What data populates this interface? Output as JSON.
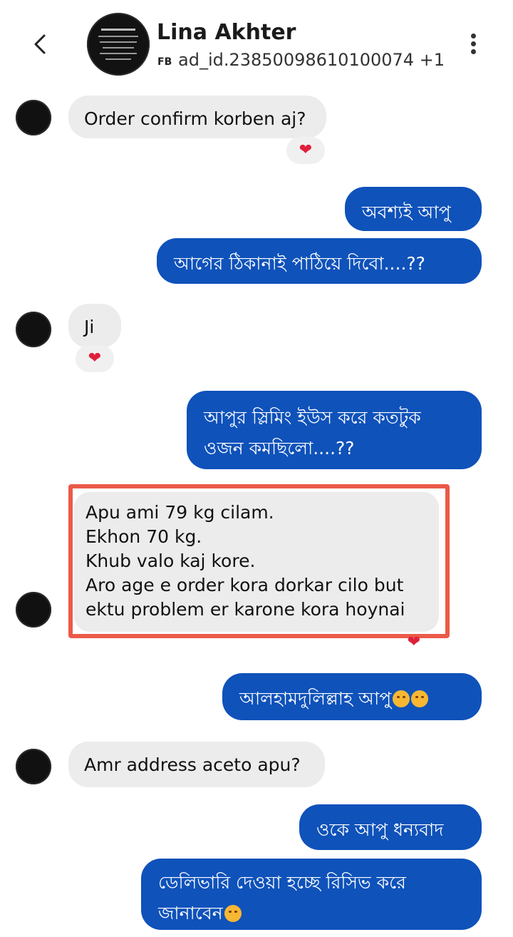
{
  "header": {
    "contact_name": "Lina Akhter",
    "source_badge": "FB",
    "subtitle": "ad_id.23850098610100074 +1",
    "back_icon": "chevron-left-icon",
    "more_icon": "more-vertical-icon"
  },
  "messages": [
    {
      "text": "Order confirm korben aj?",
      "reaction": "❤"
    },
    {
      "text": "অবশ্যই আপু"
    },
    {
      "text": "আগের ঠিকানাই পাঠিয়ে দিবো....??"
    },
    {
      "text": "Ji",
      "reaction": "❤"
    },
    {
      "lines": [
        "আপুর  স্লিমিং ইউস করে কতটুক",
        "ওজন কমছিলো....??"
      ]
    },
    {
      "lines": [
        "Apu ami 79 kg cilam.",
        "Ekhon 70 kg.",
        "Khub valo kaj kore.",
        "Aro age e order kora dorkar cilo but",
        "ektu problem er karone kora hoynai"
      ]
    },
    {
      "text": "আলহামদুলিল্লাহ আপু"
    },
    {
      "text": "Amr address aceto apu?"
    },
    {
      "text": "ওকে আপু ধন্যবাদ"
    },
    {
      "lines": [
        "ডেলিভারি দেওয়া হচ্ছে রিসিভ করে",
        "জানাবেন"
      ]
    }
  ],
  "colors": {
    "outgoing_bubble": "#0f52ba",
    "incoming_bubble": "#ececec",
    "highlight_border": "#ea5a48",
    "reaction_heart": "#e0203a"
  }
}
